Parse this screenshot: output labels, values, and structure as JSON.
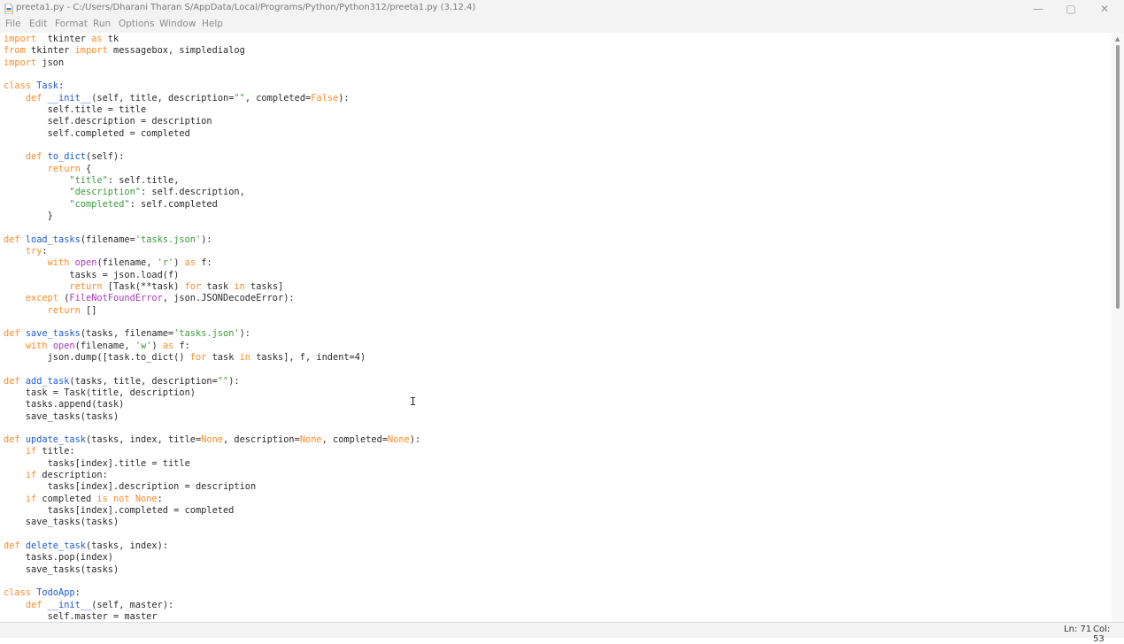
{
  "window": {
    "title": "preeta1.py - C:/Users/Dharani Tharan S/AppData/Local/Programs/Python/Python312/preeta1.py (3.12.4)",
    "minimize_glyph": "—",
    "maximize_glyph": "▢",
    "close_glyph": "✕"
  },
  "menu": [
    "File",
    "Edit",
    "Format",
    "Run",
    "Options",
    "Window",
    "Help"
  ],
  "colors": {
    "keyword": "#ff8c26",
    "function_name": "#1e5bd6",
    "string": "#3c9b3c",
    "builtin": "#a63ab6"
  },
  "code_lines": [
    [
      [
        "kw",
        "import"
      ],
      [
        "",
        "  tkinter "
      ],
      [
        "kw",
        "as"
      ],
      [
        "",
        " tk"
      ]
    ],
    [
      [
        "kw",
        "from"
      ],
      [
        "",
        " tkinter "
      ],
      [
        "kw",
        "import"
      ],
      [
        "",
        " messagebox, simpledialog"
      ]
    ],
    [
      [
        "kw",
        "import"
      ],
      [
        "",
        " json"
      ]
    ],
    [
      [
        "",
        ""
      ]
    ],
    [
      [
        "kw",
        "class"
      ],
      [
        "",
        " "
      ],
      [
        "fn",
        "Task"
      ],
      [
        "",
        ":"
      ]
    ],
    [
      [
        "",
        "    "
      ],
      [
        "kw",
        "def"
      ],
      [
        "",
        " "
      ],
      [
        "fn",
        "__init__"
      ],
      [
        "",
        "(self, title, description="
      ],
      [
        "st",
        "\"\""
      ],
      [
        "",
        ", completed="
      ],
      [
        "kw",
        "False"
      ],
      [
        "",
        "):"
      ]
    ],
    [
      [
        "",
        "        self.title = title"
      ]
    ],
    [
      [
        "",
        "        self.description = description"
      ]
    ],
    [
      [
        "",
        "        self.completed = completed"
      ]
    ],
    [
      [
        "",
        ""
      ]
    ],
    [
      [
        "",
        "    "
      ],
      [
        "kw",
        "def"
      ],
      [
        "",
        " "
      ],
      [
        "fn",
        "to_dict"
      ],
      [
        "",
        "(self):"
      ]
    ],
    [
      [
        "",
        "        "
      ],
      [
        "kw",
        "return"
      ],
      [
        "",
        " {"
      ]
    ],
    [
      [
        "",
        "            "
      ],
      [
        "st",
        "\"title\""
      ],
      [
        "",
        ": self.title,"
      ]
    ],
    [
      [
        "",
        "            "
      ],
      [
        "st",
        "\"description\""
      ],
      [
        "",
        ": self.description,"
      ]
    ],
    [
      [
        "",
        "            "
      ],
      [
        "st",
        "\"completed\""
      ],
      [
        "",
        ": self.completed"
      ]
    ],
    [
      [
        "",
        "        }"
      ]
    ],
    [
      [
        "",
        ""
      ]
    ],
    [
      [
        "kw",
        "def"
      ],
      [
        "",
        " "
      ],
      [
        "fn",
        "load_tasks"
      ],
      [
        "",
        "(filename="
      ],
      [
        "st",
        "'tasks.json'"
      ],
      [
        "",
        "):"
      ]
    ],
    [
      [
        "",
        "    "
      ],
      [
        "kw",
        "try"
      ],
      [
        "",
        ":"
      ]
    ],
    [
      [
        "",
        "        "
      ],
      [
        "kw",
        "with"
      ],
      [
        "",
        " "
      ],
      [
        "bi",
        "open"
      ],
      [
        "",
        "(filename, "
      ],
      [
        "st",
        "'r'"
      ],
      [
        "",
        ") "
      ],
      [
        "kw",
        "as"
      ],
      [
        "",
        " f:"
      ]
    ],
    [
      [
        "",
        "            tasks = json.load(f)"
      ]
    ],
    [
      [
        "",
        "            "
      ],
      [
        "kw",
        "return"
      ],
      [
        "",
        " [Task(**task) "
      ],
      [
        "kw",
        "for"
      ],
      [
        "",
        " task "
      ],
      [
        "kw",
        "in"
      ],
      [
        "",
        " tasks]"
      ]
    ],
    [
      [
        "",
        "    "
      ],
      [
        "kw",
        "except"
      ],
      [
        "",
        " ("
      ],
      [
        "bi",
        "FileNotFoundError"
      ],
      [
        "",
        ", json.JSONDecodeError):"
      ]
    ],
    [
      [
        "",
        "        "
      ],
      [
        "kw",
        "return"
      ],
      [
        "",
        " []"
      ]
    ],
    [
      [
        "",
        ""
      ]
    ],
    [
      [
        "kw",
        "def"
      ],
      [
        "",
        " "
      ],
      [
        "fn",
        "save_tasks"
      ],
      [
        "",
        "(tasks, filename="
      ],
      [
        "st",
        "'tasks.json'"
      ],
      [
        "",
        "):"
      ]
    ],
    [
      [
        "",
        "    "
      ],
      [
        "kw",
        "with"
      ],
      [
        "",
        " "
      ],
      [
        "bi",
        "open"
      ],
      [
        "",
        "(filename, "
      ],
      [
        "st",
        "'w'"
      ],
      [
        "",
        ") "
      ],
      [
        "kw",
        "as"
      ],
      [
        "",
        " f:"
      ]
    ],
    [
      [
        "",
        "        json.dump([task.to_dict() "
      ],
      [
        "kw",
        "for"
      ],
      [
        "",
        " task "
      ],
      [
        "kw",
        "in"
      ],
      [
        "",
        " tasks], f, indent=4)"
      ]
    ],
    [
      [
        "",
        ""
      ]
    ],
    [
      [
        "kw",
        "def"
      ],
      [
        "",
        " "
      ],
      [
        "fn",
        "add_task"
      ],
      [
        "",
        "(tasks, title, description="
      ],
      [
        "st",
        "\"\""
      ],
      [
        "",
        "):"
      ]
    ],
    [
      [
        "",
        "    task = Task(title, description)"
      ]
    ],
    [
      [
        "",
        "    tasks.append(task)"
      ]
    ],
    [
      [
        "",
        "    save_tasks(tasks)"
      ]
    ],
    [
      [
        "",
        ""
      ]
    ],
    [
      [
        "kw",
        "def"
      ],
      [
        "",
        " "
      ],
      [
        "fn",
        "update_task"
      ],
      [
        "",
        "(tasks, index, title="
      ],
      [
        "kw",
        "None"
      ],
      [
        "",
        ", description="
      ],
      [
        "kw",
        "None"
      ],
      [
        "",
        ", completed="
      ],
      [
        "kw",
        "None"
      ],
      [
        "",
        "):"
      ]
    ],
    [
      [
        "",
        "    "
      ],
      [
        "kw",
        "if"
      ],
      [
        "",
        " title:"
      ]
    ],
    [
      [
        "",
        "        tasks[index].title = title"
      ]
    ],
    [
      [
        "",
        "    "
      ],
      [
        "kw",
        "if"
      ],
      [
        "",
        " description:"
      ]
    ],
    [
      [
        "",
        "        tasks[index].description = description"
      ]
    ],
    [
      [
        "",
        "    "
      ],
      [
        "kw",
        "if"
      ],
      [
        "",
        " completed "
      ],
      [
        "kw",
        "is not None"
      ],
      [
        "",
        ":"
      ]
    ],
    [
      [
        "",
        "        tasks[index].completed = completed"
      ]
    ],
    [
      [
        "",
        "    save_tasks(tasks)"
      ]
    ],
    [
      [
        "",
        ""
      ]
    ],
    [
      [
        "kw",
        "def"
      ],
      [
        "",
        " "
      ],
      [
        "fn",
        "delete_task"
      ],
      [
        "",
        "(tasks, index):"
      ]
    ],
    [
      [
        "",
        "    tasks.pop(index)"
      ]
    ],
    [
      [
        "",
        "    save_tasks(tasks)"
      ]
    ],
    [
      [
        "",
        ""
      ]
    ],
    [
      [
        "kw",
        "class"
      ],
      [
        "",
        " "
      ],
      [
        "fn",
        "TodoApp"
      ],
      [
        "",
        ":"
      ]
    ],
    [
      [
        "",
        "    "
      ],
      [
        "kw",
        "def"
      ],
      [
        "",
        " "
      ],
      [
        "fn",
        "__init__"
      ],
      [
        "",
        "(self, master):"
      ]
    ],
    [
      [
        "",
        "        self.master = master"
      ]
    ]
  ],
  "cursor_glyph": "I",
  "status": {
    "line": "Ln: 71",
    "column": "Col: 53"
  }
}
